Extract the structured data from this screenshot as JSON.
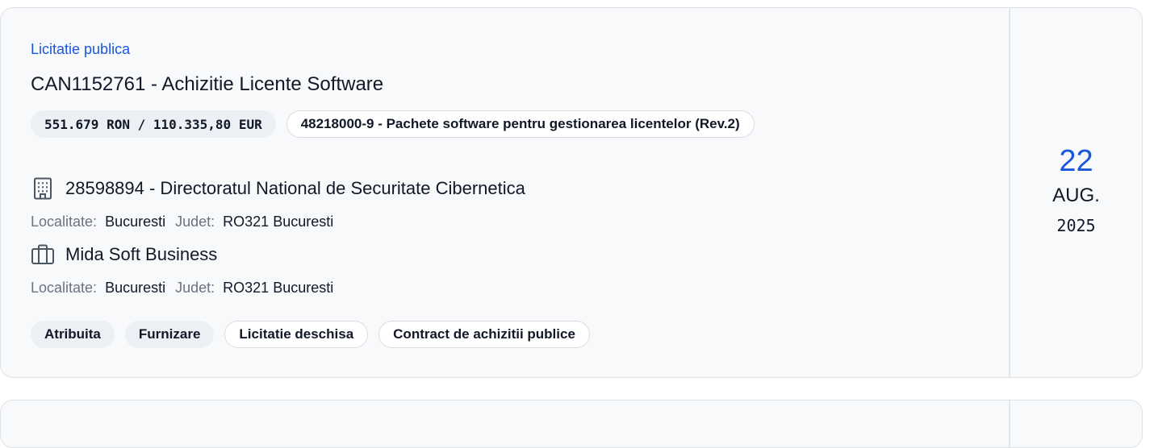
{
  "tender": {
    "type_label": "Licitatie publica",
    "title": "CAN1152761 - Achizitie Licente Software",
    "value": "551.679 RON / 110.335,80 EUR",
    "cpv": "48218000-9 - Pachete software pentru gestionarea licentelor (Rev.2)",
    "authority": {
      "name": "28598894 - Directoratul National de Securitate Cibernetica",
      "icon": "building-icon",
      "localitate_label": "Localitate:",
      "localitate": "Bucuresti",
      "judet_label": "Judet:",
      "judet": "RO321 Bucuresti"
    },
    "supplier": {
      "name": "Mida Soft Business",
      "icon": "briefcase-icon",
      "localitate_label": "Localitate:",
      "localitate": "Bucuresti",
      "judet_label": "Judet:",
      "judet": "RO321 Bucuresti"
    },
    "tags": [
      "Atribuita",
      "Furnizare",
      "Licitatie deschisa",
      "Contract de achizitii publice"
    ],
    "date": {
      "day": "22",
      "month": "AUG.",
      "year": "2025"
    }
  },
  "colors": {
    "accent": "#1a56db",
    "card_bg": "#f8f9fb",
    "muted": "#6b7280"
  }
}
